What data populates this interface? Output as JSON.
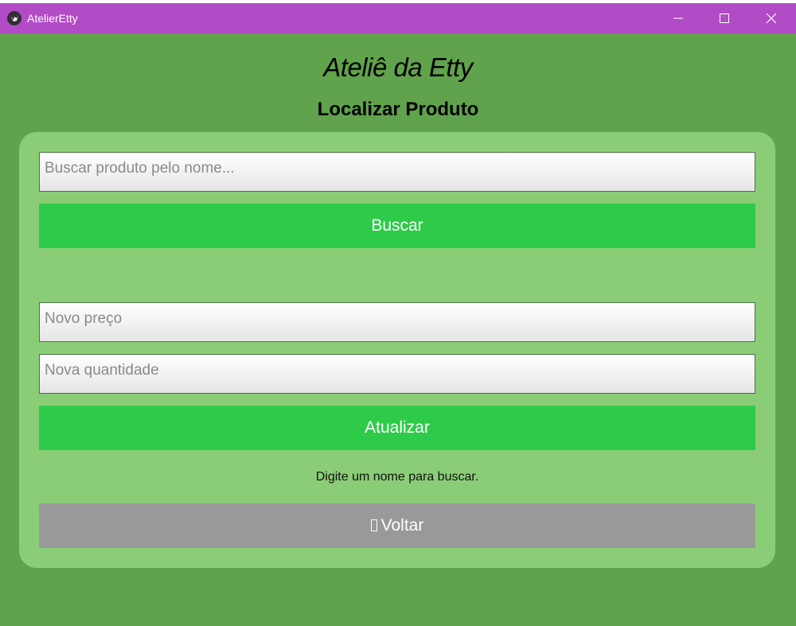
{
  "window": {
    "title": "AtelierEtty",
    "icon": "kivy-logo-icon",
    "controls": [
      "minimize-icon",
      "maximize-icon",
      "close-icon"
    ]
  },
  "header": {
    "title": "Ateliê da Etty",
    "subtitle": "Localizar Produto"
  },
  "search": {
    "placeholder": "Buscar produto pelo nome...",
    "value": "",
    "button_label": "Buscar"
  },
  "update": {
    "price_placeholder": "Novo preço",
    "price_value": "",
    "quantity_placeholder": "Nova quantidade",
    "quantity_value": "",
    "button_label": "Atualizar"
  },
  "status": {
    "message": "Digite um nome para buscar."
  },
  "back": {
    "icon": "back-arrow-icon",
    "label": "Voltar"
  },
  "colors": {
    "titlebar": "#b24bc6",
    "background": "#61a34c",
    "panel": "#8acd76",
    "primary_button": "#2ecb4a",
    "secondary_button": "#999999"
  }
}
